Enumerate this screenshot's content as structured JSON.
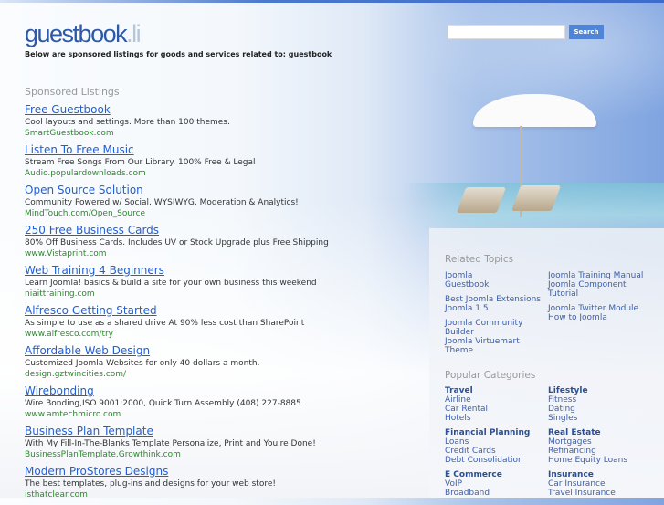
{
  "header": {
    "logo_main": "guestbook",
    "logo_tld": ".li",
    "tagline": "Below are sponsored listings for goods and services related to: guestbook"
  },
  "search": {
    "value": "",
    "button": "Search"
  },
  "sponsored": {
    "title": "Sponsored Listings",
    "items": [
      {
        "title": "Free Guestbook",
        "desc": "Cool layouts and settings. More than 100 themes.",
        "url": "SmartGuestbook.com"
      },
      {
        "title": "Listen To Free Music",
        "desc": "Stream Free Songs From Our Library. 100% Free & Legal",
        "url": "Audio.populardownloads.com"
      },
      {
        "title": "Open Source Solution",
        "desc": "Community Powered w/ Social, WYSIWYG, Moderation & Analytics!",
        "url": "MindTouch.com/Open_Source"
      },
      {
        "title": "250 Free Business Cards",
        "desc": "80% Off Business Cards. Includes UV or Stock Upgrade plus Free Shipping",
        "url": "www.Vistaprint.com"
      },
      {
        "title": "Web Training 4 Beginners",
        "desc": "Learn Joomla! basics & build a site for your own business this weekend",
        "url": "niaittraining.com"
      },
      {
        "title": "Alfresco Getting Started",
        "desc": "As simple to use as a shared drive At 90% less cost than SharePoint",
        "url": "www.alfresco.com/try"
      },
      {
        "title": "Affordable Web Design",
        "desc": "Customized Joomla Websites for only 40 dollars a month.",
        "url": "design.gztwincities.com/"
      },
      {
        "title": "Wirebonding",
        "desc": "Wire Bonding,ISO 9001:2000, Quick Turn Assembly (408) 227-8885",
        "url": "www.amtechmicro.com"
      },
      {
        "title": "Business Plan Template",
        "desc": "With My Fill-In-The-Blanks Template Personalize, Print and You're Done!",
        "url": "BusinessPlanTemplate.Growthink.com"
      },
      {
        "title": "Modern ProStores Designs",
        "desc": "The best templates, plug-ins and designs for your web store!",
        "url": "isthatclear.com"
      }
    ]
  },
  "related": {
    "title": "Related Topics",
    "col1": [
      [
        "Joomla",
        "Guestbook"
      ],
      [
        "Best Joomla Extensions",
        "Joomla 1 5"
      ],
      [
        "Joomla Community",
        "Builder",
        "Joomla Virtuemart",
        "Theme"
      ]
    ],
    "col2": [
      [
        "Joomla Training Manual",
        "Joomla Component",
        "Tutorial"
      ],
      [
        "Joomla Twitter Module",
        "How to Joomla"
      ]
    ]
  },
  "popular": {
    "title": "Popular Categories",
    "col1": [
      {
        "head": "Travel",
        "links": [
          "Airline",
          "Car Rental",
          "Hotels"
        ]
      },
      {
        "head": "Financial Planning",
        "links": [
          "Loans",
          "Credit Cards",
          "Debt Consolidation"
        ]
      },
      {
        "head": "E Commerce",
        "links": [
          "VoIP",
          "Broadband"
        ]
      }
    ],
    "col2": [
      {
        "head": "Lifestyle",
        "links": [
          "Fitness",
          "Dating",
          "Singles"
        ]
      },
      {
        "head": "Real Estate",
        "links": [
          "Mortgages",
          "Refinancing",
          "Home Equity Loans"
        ]
      },
      {
        "head": "Insurance",
        "links": [
          "Car Insurance",
          "Travel Insurance"
        ]
      }
    ]
  }
}
